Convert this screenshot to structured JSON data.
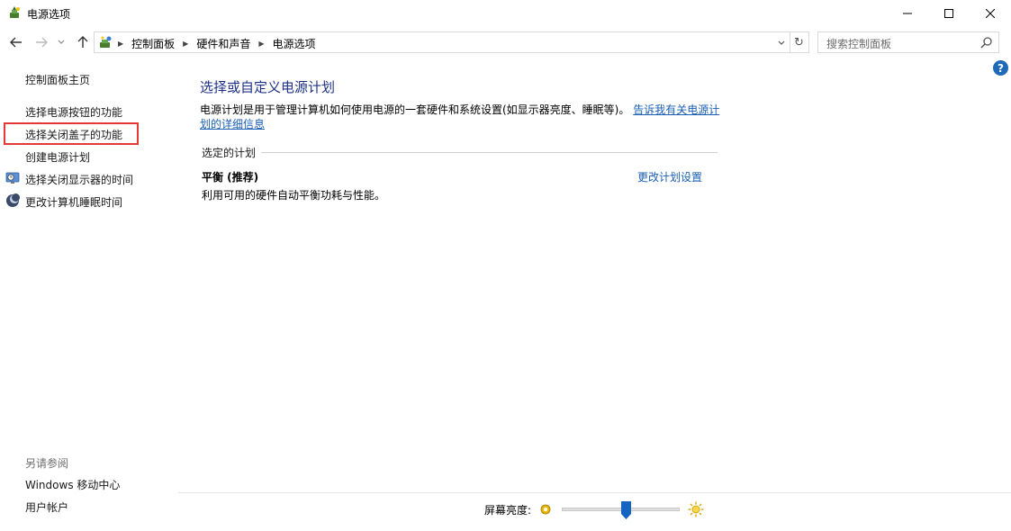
{
  "window": {
    "title": "电源选项",
    "controls": {
      "minimize": "minimize",
      "maximize": "maximize",
      "close": "close"
    }
  },
  "address_bar": {
    "crumbs": [
      "控制面板",
      "硬件和声音",
      "电源选项"
    ]
  },
  "search": {
    "placeholder": "搜索控制面板"
  },
  "sidebar": {
    "home": "控制面板主页",
    "items": [
      {
        "label": "选择电源按钮的功能",
        "icon": ""
      },
      {
        "label": "选择关闭盖子的功能",
        "icon": "",
        "highlighted": true
      },
      {
        "label": "创建电源计划",
        "icon": ""
      },
      {
        "label": "选择关闭显示器的时间",
        "icon": "monitor-clock-icon"
      },
      {
        "label": "更改计算机睡眠时间",
        "icon": "moon-icon"
      }
    ],
    "see_also": {
      "heading": "另请参阅",
      "links": [
        "Windows 移动中心",
        "用户帐户"
      ]
    }
  },
  "main": {
    "title": "选择或自定义电源计划",
    "description": "电源计划是用于管理计算机如何使用电源的一套硬件和系统设置(如显示器亮度、睡眠等)。",
    "description_link": "告诉我有关电源计划的详细信息",
    "section_label": "选定的计划",
    "plan": {
      "name": "平衡 (推荐)",
      "description": "利用可用的硬件自动平衡功耗与性能。",
      "change_link": "更改计划设置",
      "selected": true
    }
  },
  "brightness": {
    "label": "屏幕亮度:",
    "level_percent": 55
  },
  "colors": {
    "link": "#1a5fb4",
    "title": "#1e3287",
    "highlight": "#e53935"
  }
}
